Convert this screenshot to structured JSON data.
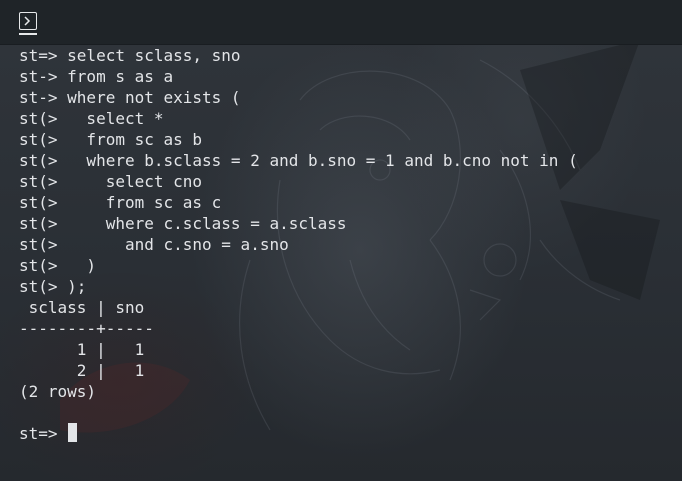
{
  "titlebar": {
    "icon": "terminal-icon"
  },
  "terminal": {
    "lines": [
      "st=> select sclass, sno",
      "st-> from s as a",
      "st-> where not exists (",
      "st(>   select *",
      "st(>   from sc as b",
      "st(>   where b.sclass = 2 and b.sno = 1 and b.cno not in (",
      "st(>     select cno",
      "st(>     from sc as c",
      "st(>     where c.sclass = a.sclass",
      "st(>       and c.sno = a.sno",
      "st(>   )",
      "st(> );",
      " sclass | sno",
      "--------+-----",
      "      1 |   1",
      "      2 |   1",
      "(2 rows)"
    ],
    "prompt": "st=> "
  }
}
